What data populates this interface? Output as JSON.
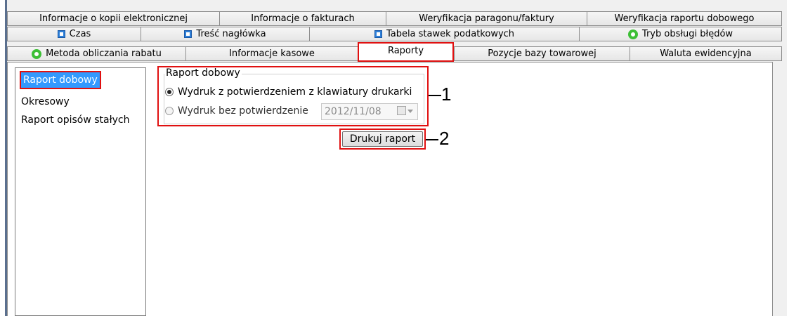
{
  "tabs": {
    "row1": [
      {
        "label": "Informacje o kopii elektronicznej"
      },
      {
        "label": "Informacje o fakturach"
      },
      {
        "label": "Weryfikacja paragonu/faktury"
      },
      {
        "label": "Weryfikacja raportu dobowego"
      }
    ],
    "row2": [
      {
        "label": "Czas",
        "icon": "blue-square-icon"
      },
      {
        "label": "Treść nagłówka",
        "icon": "blue-square-icon"
      },
      {
        "label": "Tabela stawek podatkowych",
        "icon": "blue-square-icon"
      },
      {
        "label": "Tryb obsługi błędów",
        "icon": "green-circle-icon"
      }
    ],
    "row3": [
      {
        "label": "Metoda obliczania rabatu",
        "icon": "green-circle-icon"
      },
      {
        "label": "Informacje kasowe"
      },
      {
        "label": "Raporty",
        "active": true
      },
      {
        "label": "Pozycje bazy towarowej"
      },
      {
        "label": "Waluta ewidencyjna"
      }
    ]
  },
  "sidebar": {
    "items": [
      {
        "label": "Raport dobowy",
        "selected": true
      },
      {
        "label": "Okresowy"
      },
      {
        "label": "Raport opisów stałych"
      }
    ]
  },
  "report_group": {
    "title": "Raport dobowy",
    "option_confirm": "Wydruk z potwierdzeniem z klawiatury drukarki",
    "option_no_confirm": "Wydruk bez potwierdzenie",
    "date_value": "2012/11/08",
    "selected_option": "option_confirm"
  },
  "print_button": {
    "label": "Drukuj raport"
  },
  "callouts": {
    "one": "1",
    "two": "2"
  },
  "colors": {
    "highlight_red": "#e01010",
    "selection_blue": "#3399ff",
    "icon_blue": "#2f80d8",
    "icon_green": "#3cbf35"
  }
}
